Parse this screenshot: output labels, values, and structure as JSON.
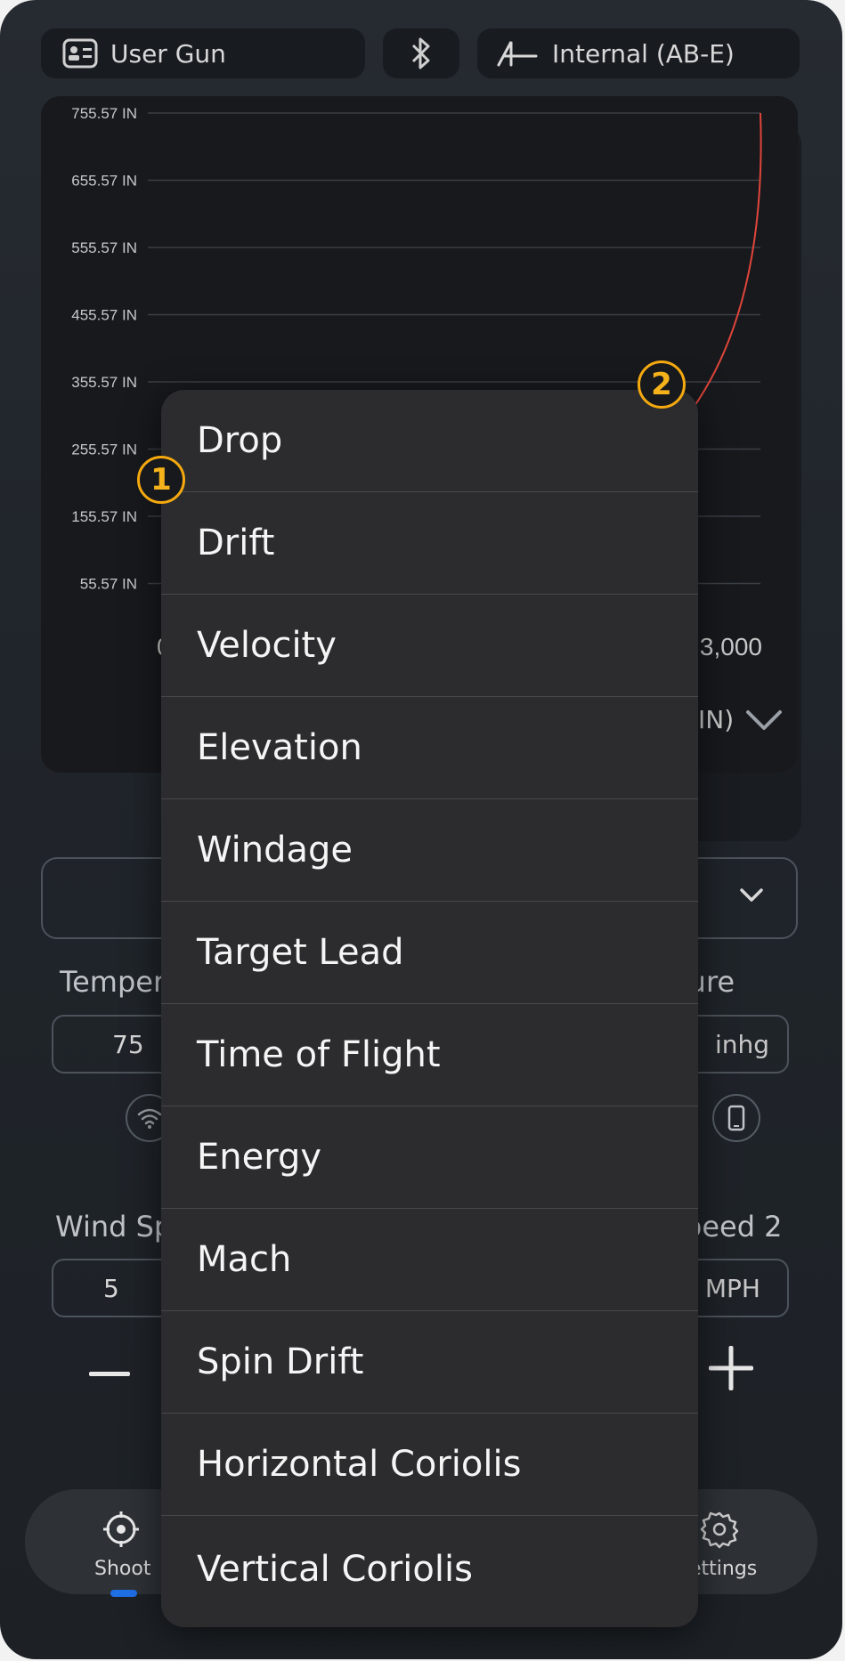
{
  "header": {
    "gun_label": "User Gun",
    "bluetooth_icon": "bluetooth-icon",
    "source_label": "Internal (AB-E)"
  },
  "chart_data": {
    "type": "line",
    "y_ticks": [
      "755.57 IN",
      "655.57 IN",
      "555.57 IN",
      "455.57 IN",
      "355.57 IN",
      "255.57 IN",
      "155.57 IN",
      "55.57 IN"
    ],
    "x_ticks": [
      "0",
      "3,000"
    ],
    "xlim": [
      0,
      3000
    ],
    "ylim": [
      0,
      755.57
    ],
    "series": [
      {
        "color": "#e0453a",
        "x": [
          0,
          2640,
          3000
        ],
        "y": [
          0,
          330,
          755.57
        ]
      }
    ],
    "axis_selector_text": "IN)",
    "grid": true
  },
  "inputs": {
    "temperature_label": "Temper",
    "temperature_value": "75",
    "pressure_label": "sure",
    "pressure_unit": "inhg",
    "wind_speed_label": "Wind Sp",
    "wind_speed_value": "5",
    "wind_speed2_label": "peed 2",
    "wind_speed2_unit": "MPH"
  },
  "tabs": {
    "shoot_label": "Shoot",
    "settings_label": "ettings"
  },
  "menu": {
    "items": [
      "Drop",
      "Drift",
      "Velocity",
      "Elevation",
      "Windage",
      "Target Lead",
      "Time of Flight",
      "Energy",
      "Mach",
      "Spin Drift",
      "Horizontal Coriolis",
      "Vertical Coriolis"
    ]
  },
  "badges": {
    "one": "1",
    "two": "2"
  },
  "colors": {
    "accent": "#f5a90f",
    "curve": "#e0453a",
    "tab_indicator": "#1f6fe5"
  }
}
